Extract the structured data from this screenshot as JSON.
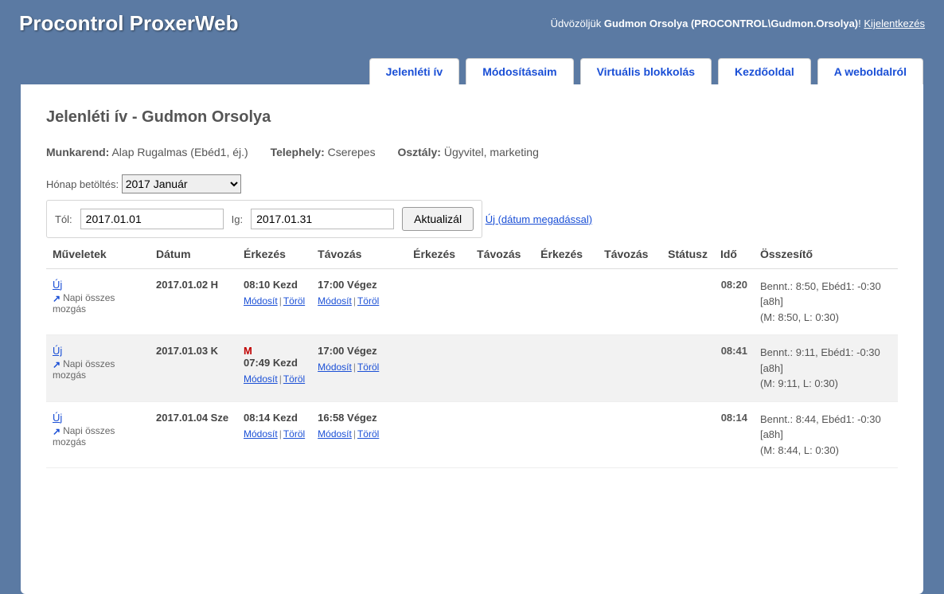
{
  "app": {
    "title": "Procontrol ProxerWeb"
  },
  "header": {
    "welcome_prefix": "Üdvözöljük",
    "username": "Gudmon Orsolya (PROCONTROL\\Gudmon.Orsolya)",
    "suffix": "!",
    "logout_label": "Kijelentkezés"
  },
  "tabs": [
    {
      "label": "Jelenléti ív"
    },
    {
      "label": "Módosításaim"
    },
    {
      "label": "Virtuális blokkolás"
    },
    {
      "label": "Kezdőoldal"
    },
    {
      "label": "A weboldalról"
    }
  ],
  "page": {
    "title": "Jelenléti ív - Gudmon Orsolya"
  },
  "meta": {
    "workorder_label": "Munkarend:",
    "workorder_value": "Alap Rugalmas (Ebéd1, éj.)",
    "site_label": "Telephely:",
    "site_value": "Cserepes",
    "dept_label": "Osztály:",
    "dept_value": "Ügyvitel, marketing"
  },
  "filter": {
    "month_label": "Hónap betöltés:",
    "month_value": "2017 Január",
    "from_label": "Tól:",
    "from_value": "2017.01.01",
    "to_label": "Ig:",
    "to_value": "2017.01.31",
    "refresh_label": "Aktualizál"
  },
  "links": {
    "new_with_date": "Új (dátum megadással)",
    "new": "Új",
    "all_moves": "Napi összes mozgás",
    "modify": "Módosít",
    "delete": "Töröl"
  },
  "columns": [
    "Műveletek",
    "Dátum",
    "Érkezés",
    "Távozás",
    "Érkezés",
    "Távozás",
    "Érkezés",
    "Távozás",
    "Státusz",
    "Idő",
    "Összesítő"
  ],
  "rows": [
    {
      "date": "2017.01.02 H",
      "arr_flag": "",
      "arr_time": "08:10 Kezd",
      "dep_time": "17:00 Végez",
      "ido": "08:20",
      "summary1": "Bennt.: 8:50, Ebéd1: -0:30",
      "summary2": "[a8h]",
      "summary3": "(M: 8:50, L: 0:30)"
    },
    {
      "date": "2017.01.03 K",
      "arr_flag": "M",
      "arr_time": "07:49 Kezd",
      "dep_time": "17:00 Végez",
      "ido": "08:41",
      "summary1": "Bennt.: 9:11, Ebéd1: -0:30",
      "summary2": "[a8h]",
      "summary3": "(M: 9:11, L: 0:30)"
    },
    {
      "date": "2017.01.04 Sze",
      "arr_flag": "",
      "arr_time": "08:14 Kezd",
      "dep_time": "16:58 Végez",
      "ido": "08:14",
      "summary1": "Bennt.: 8:44, Ebéd1: -0:30",
      "summary2": "[a8h]",
      "summary3": "(M: 8:44, L: 0:30)"
    }
  ]
}
